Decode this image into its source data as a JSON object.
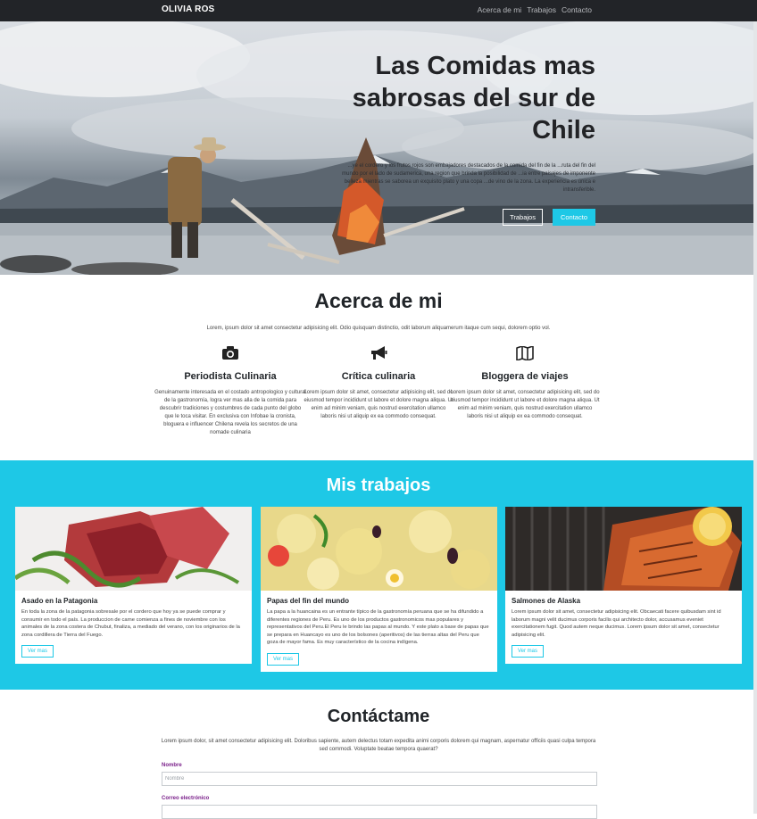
{
  "nav": {
    "brand": "OLIVIA ROS",
    "links": [
      "Acerca de mi",
      "Trabajos",
      "Contacto"
    ]
  },
  "hero": {
    "title": "Las Comidas mas sabrosas del sur de Chile",
    "text": "...ye el cordero y los frutos rojos son embajadores destacados de la comida del fin de la ...ruta del fin del mundo por el lado de sudamerica, una region que brinda la posibilidad de ...ia entre paisajes de imponente belleza mientras se saborea un exquisito plato y una copa ...de vino de la zona. La experiencia es única e intransferible.",
    "btn_works": "Trabajos",
    "btn_contact": "Contacto"
  },
  "about": {
    "title": "Acerca de mi",
    "intro": "Lorem, ipsum dolor sit amet consectetur adipisicing elit. Odio quisquam distinctio, odit laborum aliquamerum itaque cum sequi, dolorem optio vol.",
    "features": [
      {
        "icon": "camera-icon",
        "title": "Periodista Culinaria",
        "text": "Genuinamente interesada en el costado antropologico y cultural de la gastronomía, logra ver mas alla de la comida para descubrir tradiciones y costumbres de cada punto del globo que le toca visitar. En exclusiva con Infobae la cronista, bloguera e influencer Chilena revela los secretos de una nomade culinaria"
      },
      {
        "icon": "megaphone-icon",
        "title": "Crítica culinaria",
        "text": "Lorem ipsum dolor sit amet, consectetur adipisicing elit, sed do eiusmod tempor incididunt ut labore et dolore magna aliqua. Ut enim ad minim veniam, quis nostrud exercitation ullamco laboris nisi ut aliquip ex ea commodo consequat."
      },
      {
        "icon": "map-icon",
        "title": "Bloggera de viajes",
        "text": "Lorem ipsum dolor sit amet, consectetur adipisicing elit, sed do eiusmod tempor incididunt ut labore et dolore magna aliqua. Ut enim ad minim veniam, quis nostrud exercitation ullamco laboris nisi ut aliquip ex ea commodo consequat."
      }
    ]
  },
  "works": {
    "title": "Mis trabajos",
    "cards": [
      {
        "title": "Asado en la Patagonia",
        "text": "En toda la zona de la patagonia sobresale por el cordero que hoy ya se puede comprar y consumir en todo el país. La produccion de carne comienza a fines de noviembre con los animales de la zona costera de Chubut, finaliza, a mediado del verano, con los originarios de la zona cordillera de Tierra del Fuego.",
        "btn": "Ver mas"
      },
      {
        "title": "Papas del fin del mundo",
        "text": "La papa a la huancaina es un entrante típico de la gastronomía peruana que se ha difundido a diferentes regiones de Peru. Es uno de los productos gastronomicos mas populares y representativos del Peru.El Peru le brindo las papas al mundo. Y este plato a base de papas que se prepara en Huancayo es uno de los bolsones (aperitivos) de las tierras altas del Peru que goza de mayor fama. Es muy característico de la cocina indígena.",
        "btn": "Ver mas"
      },
      {
        "title": "Salmones de Alaska",
        "text": "Lorem ipsum dolor sit amet, consectetur adipisicing elit. Obcaecati facere quibusdam sint id laborum magni velit ducimus corporis facilis qui architecto dolor, accusamus eveniet exercitationem fugit. Quod autem neque ducimus. Lorem ipsum dolor sit amet, consectetur adipisicing elit.",
        "btn": "Ver mas"
      }
    ]
  },
  "contact": {
    "title": "Contáctame",
    "text": "Lorem ipsum dolor, sit amet consectetur adipisicing elit. Doloribus sapiente, autem delectus totam expedita animi corporis dolorem qui magnam, aspernatur officiis quasi culpa tempora sed commodi. Voluptate beatae tempora quaerat?",
    "name_label": "Nombre",
    "name_placeholder": "Nombre",
    "email_label": "Correo electrónico"
  },
  "colors": {
    "accent": "#1ec8e6",
    "navbar": "#222428",
    "label": "#7a1f8a"
  }
}
